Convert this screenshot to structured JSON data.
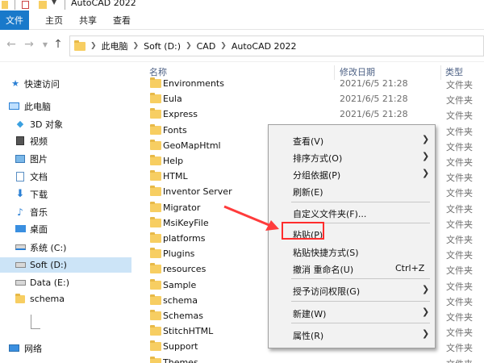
{
  "window": {
    "title": "AutoCAD 2022"
  },
  "ribbon": {
    "file": "文件",
    "tabs": [
      "主页",
      "共享",
      "查看"
    ]
  },
  "address": {
    "crumbs": [
      "此电脑",
      "Soft (D:)",
      "CAD",
      "AutoCAD 2022"
    ]
  },
  "columns": {
    "name": "名称",
    "date": "修改日期",
    "type": "类型"
  },
  "sidebar": {
    "items": [
      {
        "label": "快速访问",
        "icon": "star-icon"
      },
      {
        "label": "此电脑",
        "icon": "computer-icon"
      },
      {
        "label": "3D 对象",
        "icon": "cube-icon"
      },
      {
        "label": "视频",
        "icon": "video-icon"
      },
      {
        "label": "图片",
        "icon": "picture-icon"
      },
      {
        "label": "文档",
        "icon": "document-icon"
      },
      {
        "label": "下载",
        "icon": "download-icon"
      },
      {
        "label": "音乐",
        "icon": "music-icon"
      },
      {
        "label": "桌面",
        "icon": "desktop-icon"
      },
      {
        "label": "系统 (C:)",
        "icon": "drive-icon"
      },
      {
        "label": "Soft (D:)",
        "icon": "drive-icon",
        "selected": true
      },
      {
        "label": "Data (E:)",
        "icon": "drive-icon"
      },
      {
        "label": "schema",
        "icon": "folder-icon"
      },
      {
        "label": "网络",
        "icon": "network-icon"
      }
    ]
  },
  "files": [
    {
      "name": "Environments",
      "date": "2021/6/5 21:28",
      "type": "文件夹"
    },
    {
      "name": "Eula",
      "date": "2021/6/5 21:28",
      "type": "文件夹"
    },
    {
      "name": "Express",
      "date": "2021/6/5 21:28",
      "type": "文件夹"
    },
    {
      "name": "Fonts",
      "date": "",
      "type": "文件夹"
    },
    {
      "name": "GeoMapHtml",
      "date": "",
      "type": "文件夹"
    },
    {
      "name": "Help",
      "date": "",
      "type": "文件夹"
    },
    {
      "name": "HTML",
      "date": "",
      "type": "文件夹"
    },
    {
      "name": "Inventor Server",
      "date": "",
      "type": "文件夹"
    },
    {
      "name": "Migrator",
      "date": "",
      "type": "文件夹"
    },
    {
      "name": "MsiKeyFile",
      "date": "",
      "type": "文件夹"
    },
    {
      "name": "platforms",
      "date": "",
      "type": "文件夹"
    },
    {
      "name": "Plugins",
      "date": "",
      "type": "文件夹"
    },
    {
      "name": "resources",
      "date": "",
      "type": "文件夹"
    },
    {
      "name": "Sample",
      "date": "",
      "type": "文件夹"
    },
    {
      "name": "schema",
      "date": "",
      "type": "文件夹"
    },
    {
      "name": "Schemas",
      "date": "",
      "type": "文件夹"
    },
    {
      "name": "StitchHTML",
      "date": "",
      "type": "文件夹"
    },
    {
      "name": "Support",
      "date": "",
      "type": "文件夹"
    },
    {
      "name": "Themes",
      "date": "",
      "type": "文件夹"
    }
  ],
  "context_menu": {
    "items": [
      {
        "label": "查看(V)",
        "submenu": true
      },
      {
        "label": "排序方式(O)",
        "submenu": true
      },
      {
        "label": "分组依据(P)",
        "submenu": true
      },
      {
        "label": "刷新(E)"
      },
      {
        "label": "自定义文件夹(F)..."
      },
      {
        "label": "粘贴(P)",
        "highlighted": true
      },
      {
        "label": "粘贴快捷方式(S)"
      },
      {
        "label": "撤消 重命名(U)",
        "shortcut": "Ctrl+Z"
      },
      {
        "label": "授予访问权限(G)",
        "submenu": true
      },
      {
        "label": "新建(W)",
        "submenu": true
      },
      {
        "label": "属性(R)"
      }
    ]
  },
  "colors": {
    "accent": "#1979ca",
    "selection": "#cce4f7",
    "highlight": "#ff2d2d",
    "folder": "#f7ce62"
  }
}
